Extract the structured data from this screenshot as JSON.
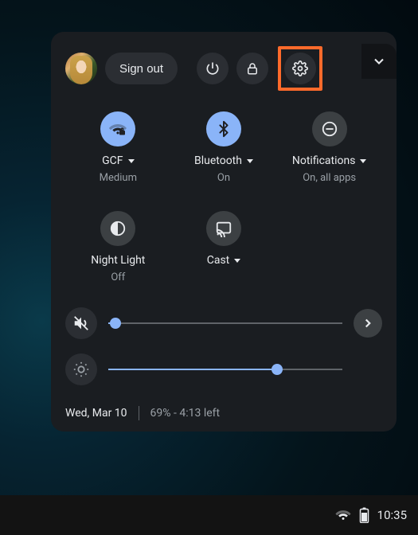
{
  "header": {
    "signout_label": "Sign out"
  },
  "tiles": {
    "wifi": {
      "label": "GCF",
      "sub": "Medium",
      "on": true,
      "has_caret": true
    },
    "bluetooth": {
      "label": "Bluetooth",
      "sub": "On",
      "on": true,
      "has_caret": true
    },
    "notifications": {
      "label": "Notifications",
      "sub": "On, all apps",
      "on": false,
      "has_caret": true
    },
    "nightlight": {
      "label": "Night Light",
      "sub": "Off",
      "on": false,
      "has_caret": false
    },
    "cast": {
      "label": "Cast",
      "sub": "",
      "on": false,
      "has_caret": true
    }
  },
  "sliders": {
    "volume": {
      "value_pct": 3
    },
    "brightness": {
      "value_pct": 72
    }
  },
  "footer": {
    "date": "Wed, Mar 10",
    "battery": "69% - 4:13 left"
  },
  "taskbar": {
    "clock": "10:35"
  }
}
